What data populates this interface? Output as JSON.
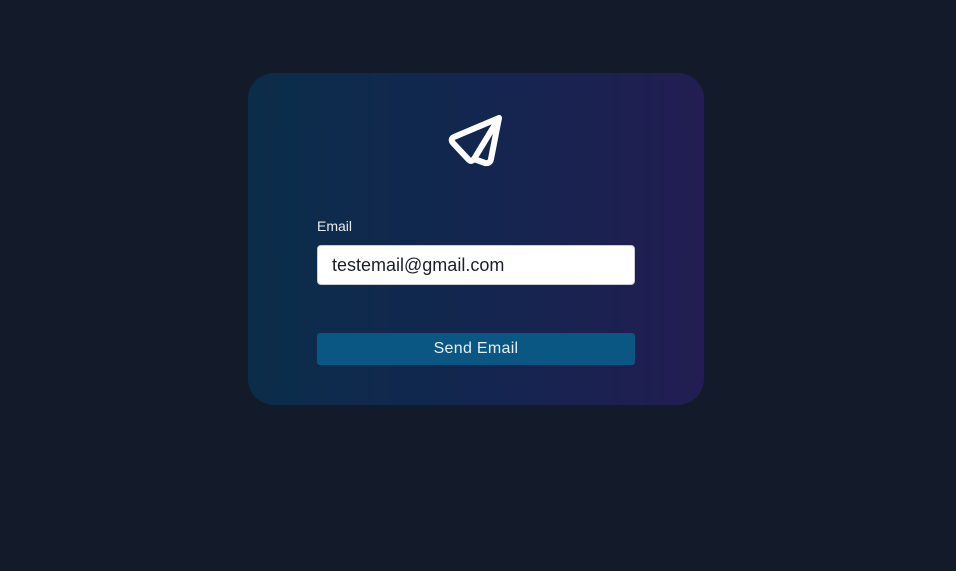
{
  "form": {
    "logo_icon": "paper-plane-icon",
    "email_label": "Email",
    "email_value": "testemail@gmail.com",
    "submit_label": "Send Email"
  },
  "colors": {
    "page_background": "#131a29",
    "card_gradient_start": "#0b2d4a",
    "card_gradient_end": "#221d52",
    "button_background": "#0a5783",
    "button_text": "#e7eef6",
    "label_text": "#e8ecf3",
    "icon": "#ffffff"
  }
}
